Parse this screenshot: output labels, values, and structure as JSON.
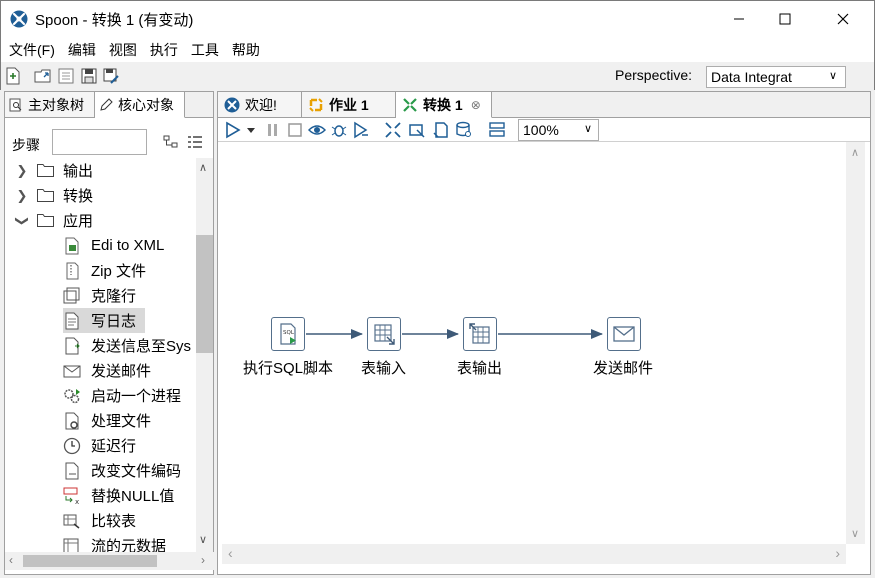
{
  "window": {
    "title": "Spoon - 转换 1 (有变动)",
    "buttons": [
      "minimize",
      "maximize",
      "close"
    ]
  },
  "menu": [
    "文件(F)",
    "编辑",
    "视图",
    "执行",
    "工具",
    "帮助"
  ],
  "toolbar": {
    "perspective_label": "Perspective:",
    "perspective_value": "Data Integrat"
  },
  "left_panel": {
    "tabs": [
      "主对象树",
      "核心对象"
    ],
    "steps_label": "步骤",
    "search_placeholder": "",
    "categories": [
      {
        "label": "输出",
        "expanded": false
      },
      {
        "label": "转换",
        "expanded": false
      },
      {
        "label": "应用",
        "expanded": true
      }
    ],
    "items": [
      "Edi to XML",
      "Zip 文件",
      "克隆行",
      "写日志",
      "发送信息至Sys",
      "发送邮件",
      "启动一个进程",
      "处理文件",
      "延迟行",
      "改变文件编码",
      "替换NULL值",
      "比较表",
      "流的元数据"
    ],
    "selected_item": "写日志"
  },
  "editor": {
    "tabs": [
      {
        "label": "欢迎!",
        "icon": "spoon-icon"
      },
      {
        "label": "作业 1",
        "icon": "job-icon"
      },
      {
        "label": "转换 1",
        "icon": "transformation-icon",
        "active": true
      }
    ],
    "zoom": "100%"
  },
  "canvas": {
    "steps": [
      {
        "label": "执行SQL脚本",
        "icon": "sql-script-icon"
      },
      {
        "label": "表输入",
        "icon": "table-input-icon"
      },
      {
        "label": "表输出",
        "icon": "table-output-icon"
      },
      {
        "label": "发送邮件",
        "icon": "mail-icon"
      }
    ],
    "hops": [
      [
        "执行SQL脚本",
        "表输入"
      ],
      [
        "表输入",
        "表输出"
      ],
      [
        "表输出",
        "发送邮件"
      ]
    ]
  },
  "colors": {
    "hop": "#3e5a78",
    "step_border": "#546f8b",
    "brand": "#1a4a7a"
  }
}
